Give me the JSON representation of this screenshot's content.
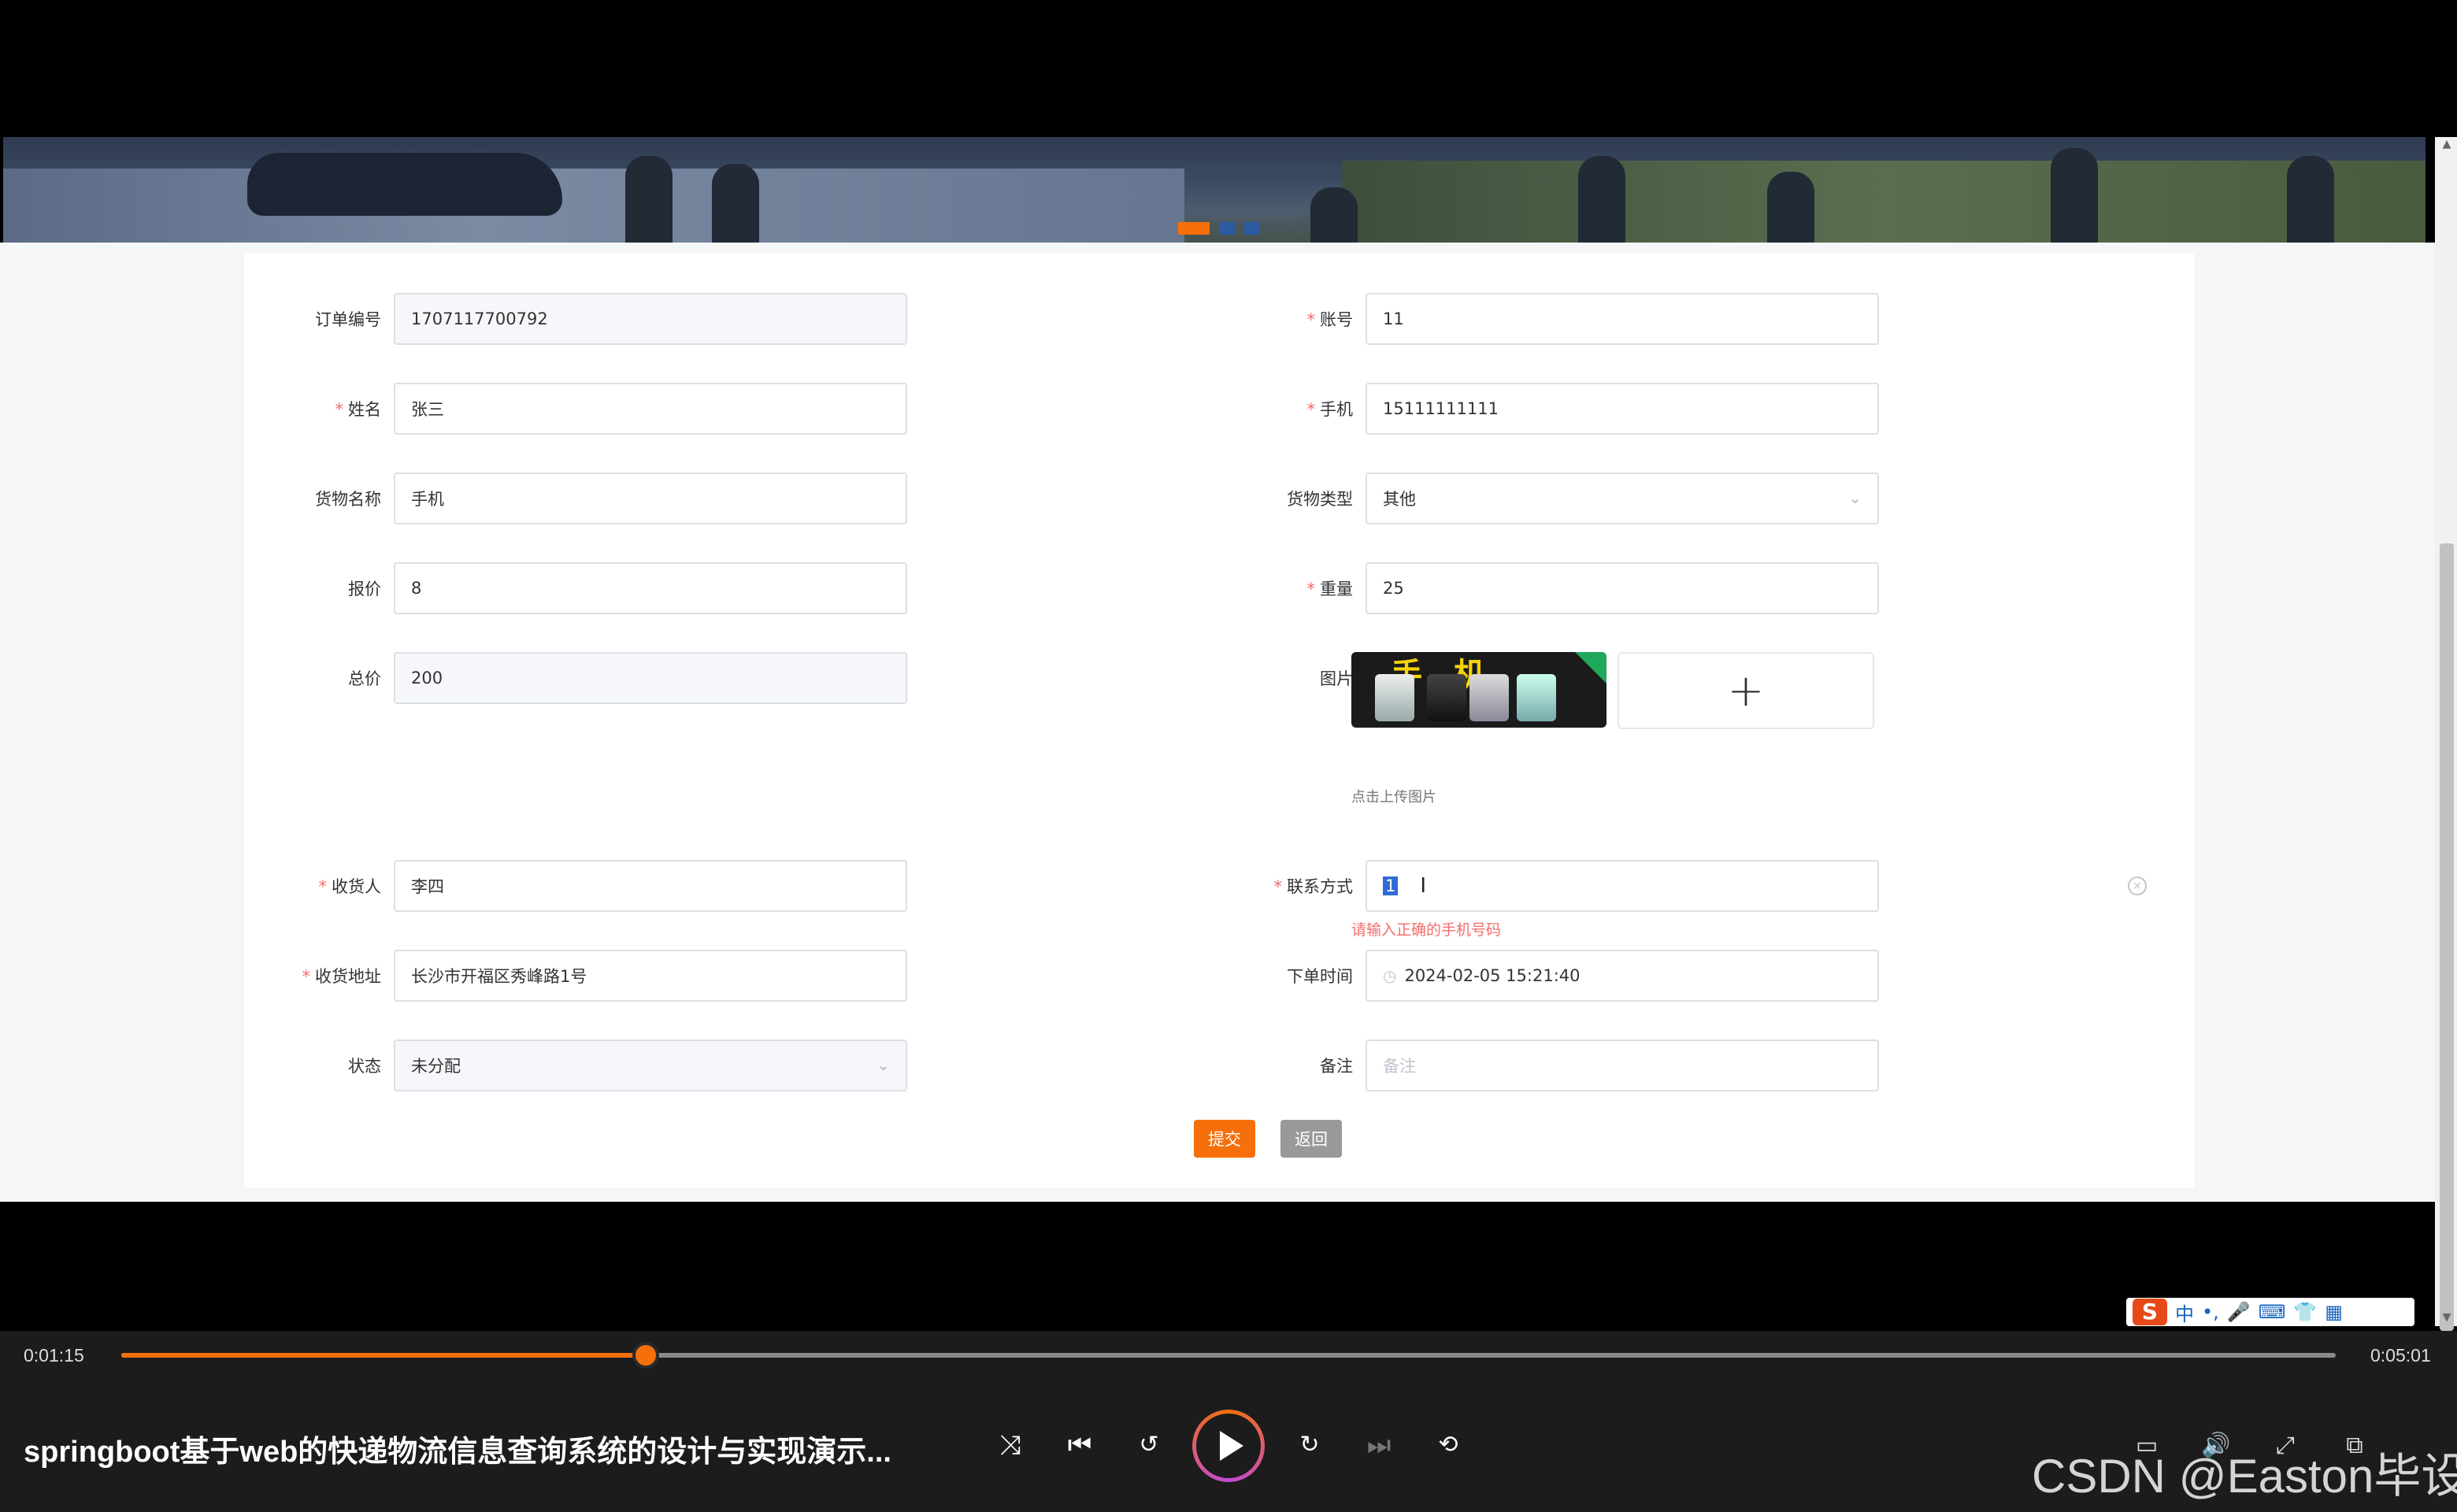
{
  "form": {
    "order_no": {
      "label": "订单编号",
      "value": "1707117700792"
    },
    "account": {
      "label": "账号",
      "value": "11"
    },
    "name": {
      "label": "姓名",
      "value": "张三"
    },
    "phone": {
      "label": "手机",
      "value": "15111111111"
    },
    "goods_name": {
      "label": "货物名称",
      "value": "手机"
    },
    "goods_type": {
      "label": "货物类型",
      "value": "其他"
    },
    "quote": {
      "label": "报价",
      "value": "8"
    },
    "weight": {
      "label": "重量",
      "value": "25"
    },
    "total": {
      "label": "总价",
      "value": "200"
    },
    "image": {
      "label": "图片",
      "thumb_text": "手机",
      "upload_hint": "点击上传图片"
    },
    "receiver": {
      "label": "收货人",
      "value": "李四"
    },
    "contact": {
      "label": "联系方式",
      "value": "1",
      "error": "请输入正确的手机号码"
    },
    "address": {
      "label": "收货地址",
      "value": "长沙市开福区秀峰路1号"
    },
    "order_time": {
      "label": "下单时间",
      "value": "2024-02-05 15:21:40"
    },
    "status": {
      "label": "状态",
      "value": "未分配"
    },
    "remark": {
      "label": "备注",
      "placeholder": "备注"
    },
    "submit_label": "提交",
    "back_label": "返回",
    "required_mark": "*"
  },
  "player": {
    "current_time": "0:01:15",
    "total_time": "0:05:01",
    "progress": 0.237,
    "title": "springboot基于web的快递物流信息查询系统的设计与实现演示...",
    "watermark": "CSDN @Easton毕设"
  },
  "ime": {
    "lang": "中"
  },
  "colors": {
    "accent": "#f5700a",
    "error": "#f56c6c",
    "back_button": "#999999"
  }
}
